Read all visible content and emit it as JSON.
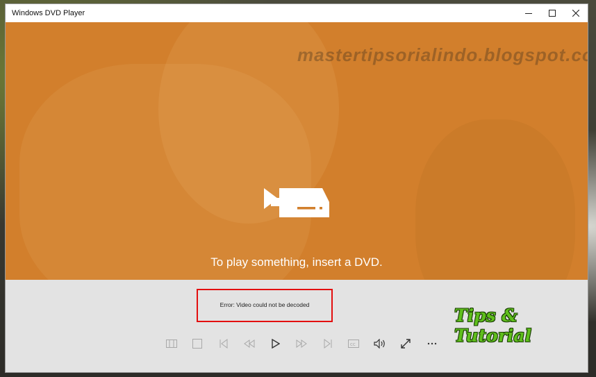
{
  "window": {
    "title": "Windows DVD Player"
  },
  "window_controls": [
    {
      "name": "minimize",
      "icon": "minimize-icon"
    },
    {
      "name": "maximize",
      "icon": "maximize-icon"
    },
    {
      "name": "close",
      "icon": "close-icon"
    }
  ],
  "video": {
    "background_color": "#d27f2c",
    "icon": "dvd-drive-icon",
    "message": "To play something, insert a DVD."
  },
  "error": {
    "text": "Error: Video could not be decoded",
    "highlight_color": "#e30e0e"
  },
  "controls": [
    {
      "name": "chapters",
      "icon": "chapters-icon"
    },
    {
      "name": "stop",
      "icon": "stop-icon"
    },
    {
      "name": "previous",
      "icon": "skip-previous-icon"
    },
    {
      "name": "rewind",
      "icon": "rewind-icon"
    },
    {
      "name": "play",
      "icon": "play-icon"
    },
    {
      "name": "fast-forward",
      "icon": "fast-forward-icon"
    },
    {
      "name": "next",
      "icon": "skip-next-icon"
    },
    {
      "name": "subtitles",
      "icon": "subtitles-icon"
    },
    {
      "name": "volume",
      "icon": "volume-icon"
    },
    {
      "name": "fullscreen",
      "icon": "fullscreen-icon"
    },
    {
      "name": "more",
      "icon": "more-icon"
    }
  ],
  "overlays": {
    "watermark": "mastertipsorialindo.blogspot.com",
    "logo": "Tips & Tutorial"
  }
}
